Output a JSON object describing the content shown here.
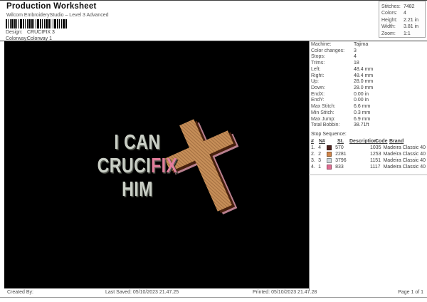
{
  "header": {
    "title": "Production Worksheet",
    "subtitle": "Wilcom EmbroideryStudio – Level 3 Advanced",
    "design_label": "Design:",
    "design_value": "CRUCIFIX 3",
    "colorway_label": "Colorway:",
    "colorway_value": "Colorway 1"
  },
  "summary_box": {
    "rows": [
      {
        "label": "Stitches:",
        "value": "7482"
      },
      {
        "label": "Colors:",
        "value": "4"
      },
      {
        "label": "Height:",
        "value": "2.21 in"
      },
      {
        "label": "Width:",
        "value": "3.81 in"
      },
      {
        "label": "Zoom:",
        "value": "1:1"
      }
    ]
  },
  "machine_info": {
    "rows": [
      {
        "label": "Machine:",
        "value": "Tajima"
      },
      {
        "label": "Color changes:",
        "value": "3"
      },
      {
        "label": "Stops:",
        "value": "4"
      },
      {
        "label": "Trims:",
        "value": "18"
      },
      {
        "label": "Left:",
        "value": "48.4 mm"
      },
      {
        "label": "Right:",
        "value": "48.4 mm"
      },
      {
        "label": "Up:",
        "value": "28.0 mm"
      },
      {
        "label": "Down:",
        "value": "28.0 mm"
      },
      {
        "label": "EndX:",
        "value": "0.00 in"
      },
      {
        "label": "EndY:",
        "value": "0.00 in"
      },
      {
        "label": "Max Stitch:",
        "value": "6.6 mm"
      },
      {
        "label": "Min Stitch:",
        "value": "0.3 mm"
      },
      {
        "label": "Max Jump:",
        "value": "6.9 mm"
      },
      {
        "label": "Total Bobbin:",
        "value": "38.71ft"
      }
    ]
  },
  "stop_sequence": {
    "title": "Stop Sequence:",
    "columns": {
      "num": "#",
      "n": "N#",
      "st": "St.",
      "description": "Description",
      "code": "Code",
      "brand": "Brand"
    },
    "rows": [
      {
        "num": "1.",
        "n": "4",
        "swatch": "#512420",
        "st": "570",
        "description": "",
        "code": "1035",
        "brand": "Madeira Classic 40"
      },
      {
        "num": "2.",
        "n": "2",
        "swatch": "#d0854a",
        "st": "2281",
        "description": "",
        "code": "1253",
        "brand": "Madeira Classic 40"
      },
      {
        "num": "3.",
        "n": "3",
        "swatch": "#ccd7db",
        "st": "3796",
        "description": "",
        "code": "1151",
        "brand": "Madeira Classic 40"
      },
      {
        "num": "4.",
        "n": "1",
        "swatch": "#df6d92",
        "st": "833",
        "description": "",
        "code": "1117",
        "brand": "Madeira Classic 40"
      }
    ]
  },
  "design_preview": {
    "line1": "I CAN",
    "line2_white": "CRUCI",
    "line2_pink": "FIX",
    "line3": "HIM",
    "text_color": "#cacfc6",
    "accent_color": "#e27e9b",
    "background": "#000000",
    "cross_fill": "#c68e58",
    "cross_stroke": "#a9743f",
    "cross_shadow": "#47200d",
    "cross_edge": "#b87f8e"
  },
  "footer": {
    "created_by": "Created By:",
    "last_saved": "Last Saved: 05/10/2023 21.47.25",
    "printed": "Printed: 05/10/2023 21.47.28",
    "page": "Page 1 of 1"
  }
}
